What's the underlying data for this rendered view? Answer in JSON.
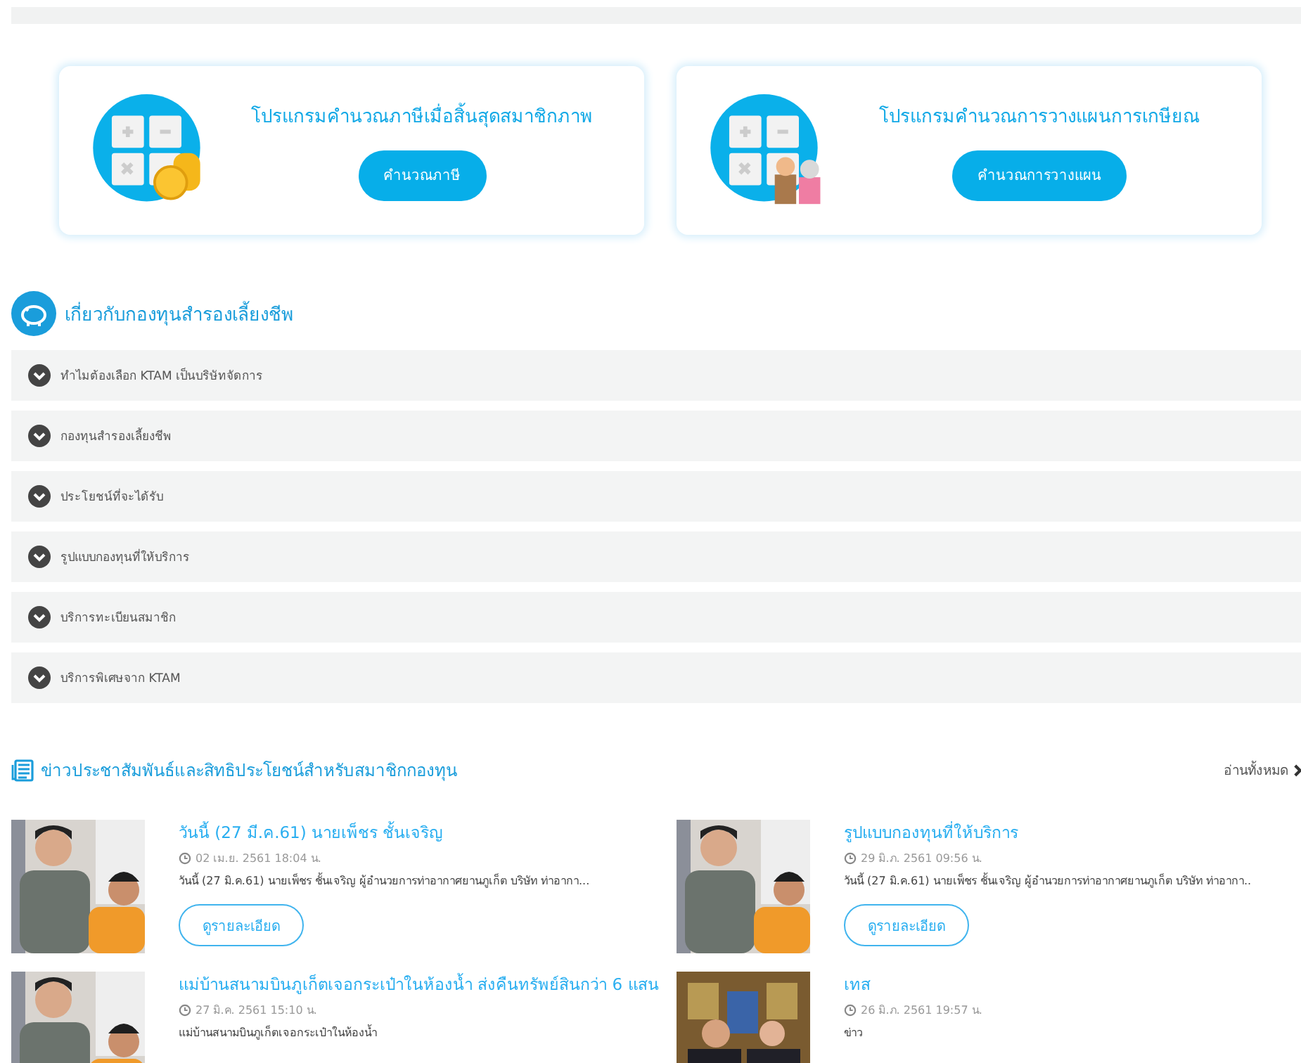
{
  "calculators": [
    {
      "title": "โปรแกรมคำนวณภาษีเมื่อสิ้นสุดสมาชิกภาพ",
      "button": "คำนวณภาษี",
      "kind": "coins"
    },
    {
      "title": "โปรแกรมคำนวณการวางแผนการเกษียณ",
      "button": "คำนวณการวางแผน",
      "kind": "elders"
    }
  ],
  "about": {
    "title": "เกี่ยวกับกองทุนสำรองเลี้ยงชีพ",
    "items": [
      {
        "label": "ทำไมต้องเลือก KTAM เป็นบริษัทจัดการ"
      },
      {
        "label": "กองทุนสำรองเลี้ยงชีพ"
      },
      {
        "label": "ประโยชน์ที่จะได้รับ"
      },
      {
        "label": "รูปแบบกองทุนที่ให้บริการ"
      },
      {
        "label": "บริการทะเบียนสมาชิก"
      },
      {
        "label": "บริการพิเศษจาก KTAM"
      }
    ]
  },
  "news": {
    "title": "ข่าวประชาสัมพันธ์และสิทธิประโยชน์สำหรับสมาชิกกองทุน",
    "read_all": "อ่านทั้งหมด",
    "items": [
      {
        "title": "วันนี้ (27 มี.ค.61) นายเพ็ชร ชั้นเจริญ",
        "date": "02 เม.ย. 2561 18:04 น.",
        "summary": "วันนี้ (27 มิ.ค.61) นายเพ็ชร ชั้นเจริญ ผู้อำนวยการท่าอากาศยานภูเก็ต บริษัท ท่าอากา...",
        "button": "ดูรายละเอียด",
        "kind": "picture"
      },
      {
        "title": "รูปแบบกองทุนที่ให้บริการ",
        "date": "29 มิ.ภ. 2561 09:56 น.",
        "summary": "วันนี้ (27 มิ.ค.61) นายเพ็ชร ชั้นเจริญ ผู้อำนวยการท่าอากาศยานภูเก็ต บริษัท ท่าอากา..",
        "button": "ดูรายละเอียด",
        "kind": "picture"
      },
      {
        "title": "แม่บ้านสนามบินภูเก็ตเจอกระเป๋าในห้องน้ำ ส่งคืนทรัพย์สินกว่า 6 แสน",
        "date": "27 มิ.ค. 2561 15:10 น.",
        "summary": "แม่บ้านสนามบินภูเก็ตเจอกระเป๋าในห้องน้ำ",
        "kind": "picture"
      },
      {
        "title": "เทส",
        "date": "26 มิ.ภ. 2561 19:57 น.",
        "summary": "ข่าว",
        "kind": "picture"
      }
    ]
  }
}
